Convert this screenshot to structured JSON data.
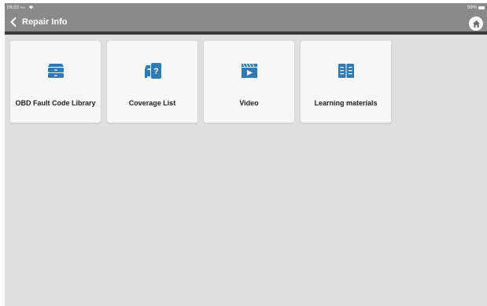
{
  "status_bar": {
    "time": "06:03",
    "ampm": "PM",
    "battery": "99%"
  },
  "header": {
    "title": "Repair Info"
  },
  "cards": [
    {
      "label": "OBD Fault Code Library",
      "icon": "drawer-icon"
    },
    {
      "label": "Coverage List",
      "icon": "car-question-icon"
    },
    {
      "label": "Video",
      "icon": "clapperboard-play-icon"
    },
    {
      "label": "Learning materials",
      "icon": "open-book-icon"
    }
  ],
  "colors": {
    "accent": "#2f79b4",
    "header": "#8a8a8a",
    "background": "#dfdfe0"
  }
}
